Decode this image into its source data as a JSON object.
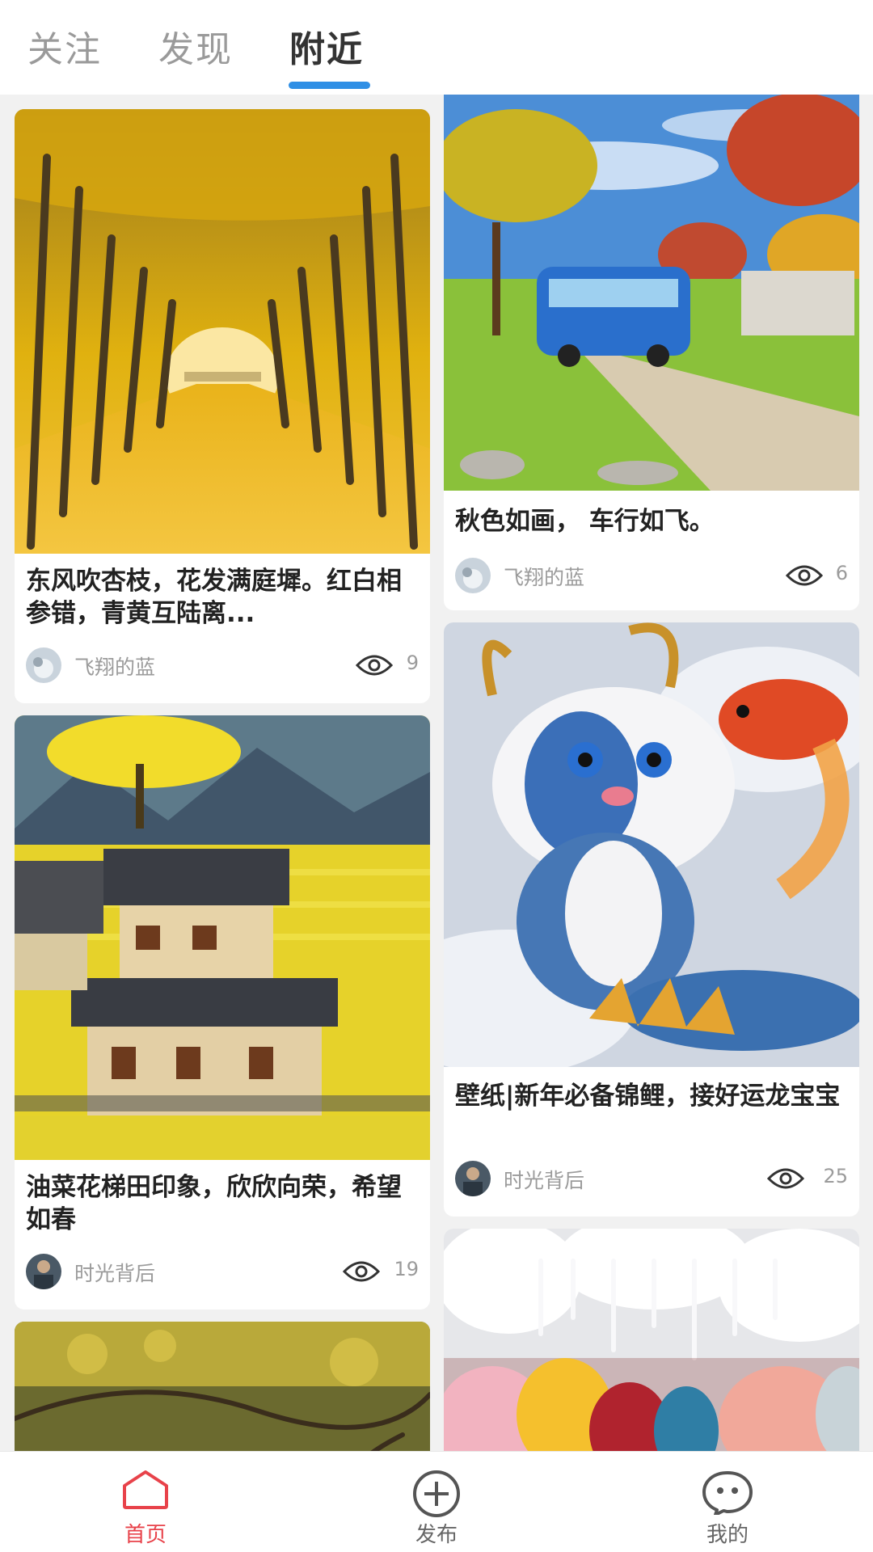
{
  "tabs": [
    {
      "label": "关注",
      "active": false
    },
    {
      "label": "发现",
      "active": false
    },
    {
      "label": "附近",
      "active": true
    }
  ],
  "accent_color": "#2f8fe5",
  "active_nav_color": "#e8424a",
  "feed": {
    "left": [
      {
        "title": "东风吹杏枝，花发满庭墀。红白相参错，青黄互陆离...",
        "author": "飞翔的蓝",
        "views": "9",
        "image": "yellow ginkgo tree tunnel"
      },
      {
        "title": "油菜花梯田印象，欣欣向荣，希望如春",
        "author": "时光背后",
        "views": "19",
        "image": "village houses among rapeseed fields"
      },
      {
        "image": "autumn tree branches"
      }
    ],
    "right": [
      {
        "title": "秋色如画， 车行如飞。",
        "author": "飞翔的蓝",
        "views": "6",
        "image": "blue van on countryside road"
      },
      {
        "title": "壁纸|新年必备锦鲤，接好运龙宝宝",
        "author": "时光背后",
        "views": "25",
        "image": "cute dragon kitten with koi fish"
      },
      {
        "image": "snowy icicle cave with jackets"
      }
    ]
  },
  "nav": [
    {
      "label": "首页",
      "icon": "home-icon",
      "active": true
    },
    {
      "label": "发布",
      "icon": "plus-circle-icon",
      "active": false
    },
    {
      "label": "我的",
      "icon": "face-icon",
      "active": false
    }
  ]
}
